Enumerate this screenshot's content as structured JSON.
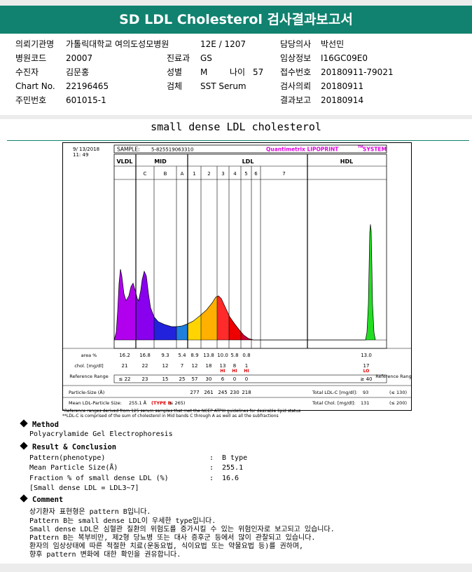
{
  "header": {
    "title": "SD LDL Cholesterol 검사결과보고서"
  },
  "info": {
    "hospital_label": "의뢰기관명",
    "hospital_value": "가톨릭대학교 여의도성모병원",
    "ward_value": "12E / 1207",
    "doctor_label": "담당의사",
    "doctor_value": "박선민",
    "hosp_code_label": "병원코드",
    "hosp_code_value": "20007",
    "dept_label": "진료과",
    "dept_value": "GS",
    "clinical_label": "임상정보",
    "clinical_value": "I16GC09E0",
    "patient_label": "수진자",
    "patient_value": "김문홍",
    "sex_label": "성별",
    "sex_value": "M",
    "age_label": "나이",
    "age_value": "57",
    "receipt_label": "접수번호",
    "receipt_value": "20180911-79021",
    "chart_label": "Chart No.",
    "chart_value": "22196465",
    "specimen_label": "검체",
    "specimen_value": "SST Serum",
    "request_label": "검사의뢰",
    "request_value": "20180911",
    "ssn_label": "주민번호",
    "ssn_value": "601015-1",
    "report_label": "결과보고",
    "report_value": "20180914"
  },
  "report_title": "small dense LDL cholesterol",
  "chart_data": {
    "type": "area",
    "date": "9/ 13/2018",
    "time": "11: 49",
    "sample_label": "SAMPLE:",
    "sample_value": "5-825519063310",
    "brand_left": "Quantimetrix LIPOPRINT",
    "brand_tm": "TM",
    "brand_right": "SYSTEM",
    "groups": [
      "VLDL",
      "MID",
      "LDL",
      "HDL"
    ],
    "bands": [
      "C",
      "B",
      "A",
      "1",
      "2",
      "3",
      "4",
      "5",
      "6",
      "7"
    ],
    "band_colors": {
      "VLDL": "#b000ee",
      "C": "#8800ee",
      "B": "#2222dd",
      "A": "#1f7fdd",
      "1": "#ffd400",
      "2": "#ffb000",
      "3": "#ff2a2a",
      "4": "#ee0000",
      "5": "#cc0033",
      "6": "#cc0033",
      "7": "#cc0033",
      "HDL": "#22dd22"
    },
    "row_labels": {
      "area": "area %",
      "chol": "chol. [mg/dl]",
      "ref": "Reference Range",
      "size": "Particle-Size (Å)",
      "mean": "Mean LDL-Particle Size:"
    },
    "area": {
      "VLDL": "16.2",
      "C": "16.8",
      "B": "9.3",
      "A": "5.4",
      "1": "8.9",
      "2": "13.8",
      "3": "10.0",
      "4": "5.8",
      "5": "0.8",
      "HDL": "13.0"
    },
    "chol": {
      "VLDL": "21",
      "C": "22",
      "B": "12",
      "A": "7",
      "1": "12",
      "2": "18",
      "3": "13",
      "4": "8",
      "5": "1",
      "HDL": "17"
    },
    "flags": {
      "3": "HI",
      "4": "HI",
      "5": "HI",
      "HDL": "LO"
    },
    "reference": {
      "VLDL": "≤ 22",
      "C": "23",
      "B": "15",
      "A": "25",
      "1": "57",
      "2": "30",
      "3": "6",
      "4": "0",
      "5": "0",
      "HDL": "≥ 40"
    },
    "particle_size": {
      "1": "277",
      "2": "261",
      "3": "245",
      "4": "230",
      "5": "218"
    },
    "mean_ldl_size": "255.1 Å",
    "mean_type": "(TYPE B",
    "mean_type_ref": "≤ 265)",
    "total_ldl_label": "Total LDL-C [mg/dl]:",
    "total_ldl_value": "93",
    "total_ldl_ref": "(≤ 130)",
    "total_chol_label": "Total Chol. [mg/dl]:",
    "total_chol_value": "131",
    "total_chol_ref": "(≤ 200)",
    "ref_header": "Reference Range"
  },
  "footnotes": {
    "f1": "*Reference ranges derived from 125 serum samples that met the NCEP ATPIII guidelines for desirable lipid status",
    "f2": "**LDL-C is comprised of the sum of cholesterol in Mid bands C through A as well as all the subfractions"
  },
  "method": {
    "heading": "Method",
    "text": "Polyacrylamide Gel Electrophoresis"
  },
  "result": {
    "heading": "Result & Conclusion",
    "rows": [
      {
        "label": "Pattern(phenotype)",
        "colon": ":",
        "value": "B type"
      },
      {
        "label": "Mean Particle Size(Å)",
        "colon": ":",
        "value": "255.1"
      },
      {
        "label": "Fraction % of small dense LDL (%)",
        "colon": ":",
        "value": "16.6"
      }
    ],
    "note": "[Small dense LDL = LDL3~7]"
  },
  "comment": {
    "heading": "Comment",
    "lines": [
      "상기환자 표현형은 pattern B입니다.",
      "Pattern B는 small dense LDL이 우세한 type입니다.",
      "Small dense LDL은 심혈관 질환의 위험도를 증가시킬 수 있는 위험인자로 보고되고 있습니다.",
      "Pattern B는 복부비만, 제2형 당뇨병 또는 대사 증후군 등에서 많이 관찰되고 있습니다.",
      "환자의 임상상태에 따른 적절한 치료(운동요법, 식이요법 또는 약물요법 등)를 권하며,",
      "향후 pattern 변화에 대한 확인을 권유합니다."
    ]
  }
}
